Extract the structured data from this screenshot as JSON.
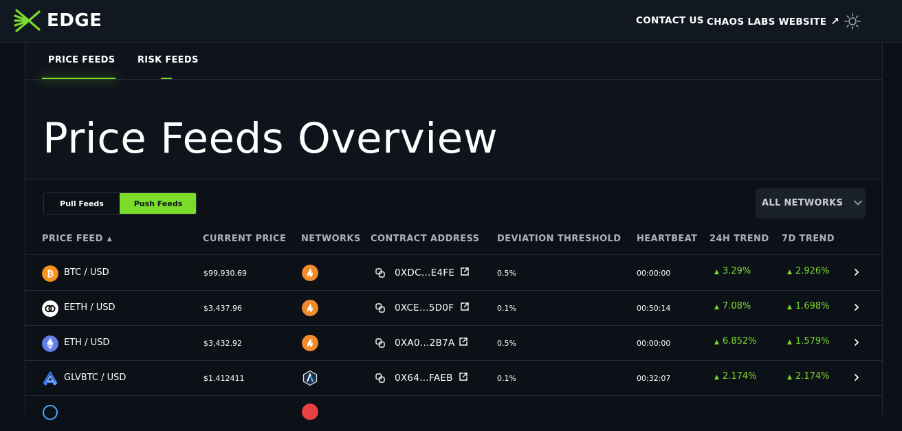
{
  "brand": {
    "name": "EDGE",
    "accent": "#7bdb2b"
  },
  "topnav": {
    "contact": "CONTACT US",
    "website": "CHAOS LABS WEBSITE"
  },
  "tabs": [
    {
      "label": "PRICE FEEDS",
      "active": true
    },
    {
      "label": "RISK FEEDS",
      "active": false
    }
  ],
  "page": {
    "title": "Price Feeds Overview"
  },
  "toggle": {
    "pull": "Pull Feeds",
    "push": "Push Feeds",
    "selected": "Push Feeds"
  },
  "network_filter": {
    "value": "ALL NETWORKS"
  },
  "columns": [
    "PRICE FEED",
    "CURRENT PRICE",
    "NETWORKS",
    "CONTRACT ADDRESS",
    "DEVIATION THRESHOLD",
    "HEARTBEAT",
    "24H TREND",
    "7D TREND"
  ],
  "rows": [
    {
      "pair": "BTC / USD",
      "icon": "btc-icon",
      "price": "$99,930.69",
      "network_icon": "flame-network-icon",
      "address": "0XDC...E4FE",
      "deviation": "0.5%",
      "heartbeat": "00:00:00",
      "trend24": "3.29%",
      "trend7": "2.926%"
    },
    {
      "pair": "EETH / USD",
      "icon": "eeth-icon",
      "price": "$3,437.96",
      "network_icon": "flame-network-icon",
      "address": "0XCE...5D0F",
      "deviation": "0.1%",
      "heartbeat": "00:50:14",
      "trend24": "7.08%",
      "trend7": "1.698%"
    },
    {
      "pair": "ETH / USD",
      "icon": "eth-icon",
      "price": "$3,432.92",
      "network_icon": "flame-network-icon",
      "address": "0XA0...2B7A",
      "deviation": "0.5%",
      "heartbeat": "00:00:00",
      "trend24": "6.852%",
      "trend7": "1.579%"
    },
    {
      "pair": "GLVBTC / USD",
      "icon": "glv-icon",
      "price": "$1.412411",
      "network_icon": "arbitrum-network-icon",
      "address": "0X64...FAEB",
      "deviation": "0.1%",
      "heartbeat": "00:32:07",
      "trend24": "2.174%",
      "trend7": "2.174%"
    }
  ]
}
